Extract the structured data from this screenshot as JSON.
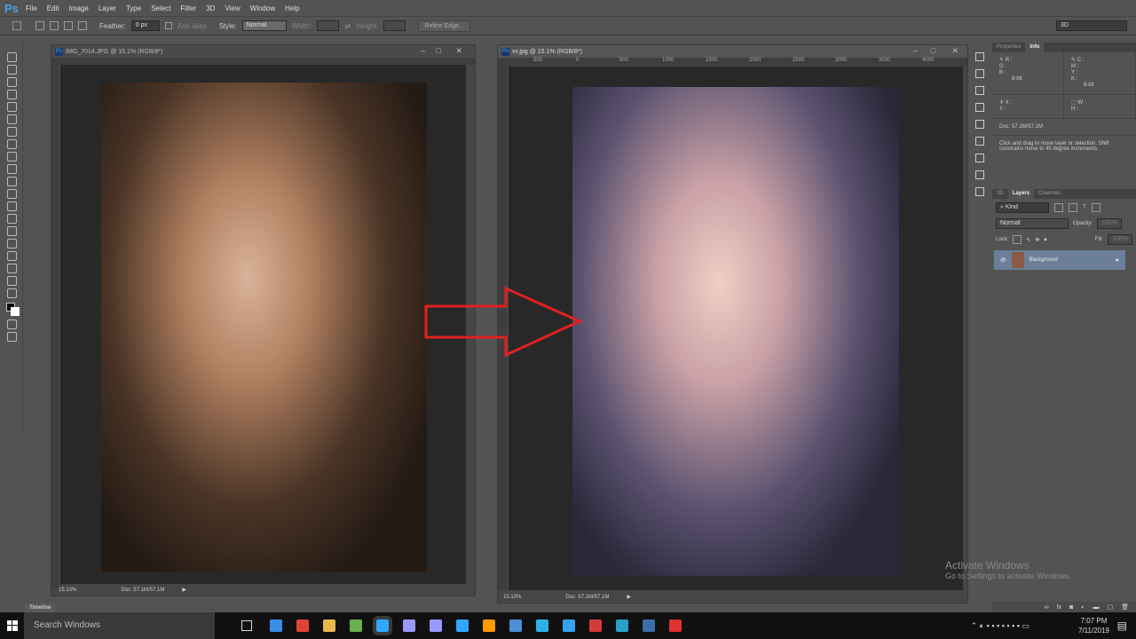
{
  "menubar": {
    "logo": "Ps",
    "items": [
      "File",
      "Edit",
      "Image",
      "Layer",
      "Type",
      "Select",
      "Filter",
      "3D",
      "View",
      "Window",
      "Help"
    ]
  },
  "options": {
    "feather_label": "Feather:",
    "feather_value": "0 px",
    "antialias": "Anti-alias",
    "style_label": "Style:",
    "style_value": "Normal",
    "width_label": "Width:",
    "height_label": "Height:",
    "refine": "Refine Edge...",
    "workspace": "3D"
  },
  "doc_left": {
    "title": "IMG_7014.JPG @ 15.1% (RGB/8*)",
    "zoom": "15.13%",
    "doc": "Doc: 57.1M/57.1M"
  },
  "doc_right": {
    "title": "vv.jpg @ 15.1% (RGB/8*)",
    "zoom": "15.13%",
    "doc": "Doc: 57.1M/57.1M",
    "ruler": [
      "500",
      "0",
      "500",
      "1000",
      "1500",
      "2000",
      "2500",
      "3000",
      "3500",
      "4000"
    ]
  },
  "info": {
    "tabs": [
      "Properties",
      "Info"
    ],
    "rgb": "R :\nG :\nB :",
    "cmyk": "C :\nM :\nY :\nK :",
    "bit1": "8-bit",
    "bit2": "8-bit",
    "xy": "X :\nY :",
    "wh": "W :\nH :",
    "doc": "Doc: 57.1M/57.1M",
    "hint": "Click and drag to move layer or selection. Shift constrains move to 45 degree increments."
  },
  "layers": {
    "tabs": [
      "3D",
      "Layers",
      "Channels"
    ],
    "kind": "Kind",
    "blend": "Normal",
    "opacity_label": "Opacity:",
    "opacity": "100%",
    "lock_label": "Lock:",
    "fill_label": "Fill:",
    "fill": "100%",
    "layer_name": "Background"
  },
  "timeline": "Timeline",
  "taskbar": {
    "search": "Search Windows",
    "time": "7:07 PM",
    "date": "7/11/2019",
    "apps_colors": [
      "#3a8ee6",
      "#db4437",
      "#e8b84a",
      "#6ab04c",
      "#31a8ff",
      "#9999ff",
      "#9999ff",
      "#31a8ff",
      "#ff9a00",
      "#4a90d9",
      "#2bb3e8",
      "#35a2f0",
      "#d63b3b",
      "#2aa0c8",
      "#3b6ea8",
      "#e03030"
    ]
  },
  "watermark": {
    "title": "Activate Windows",
    "sub": "Go to Settings to activate Windows."
  },
  "arrow_color": "#e02020"
}
